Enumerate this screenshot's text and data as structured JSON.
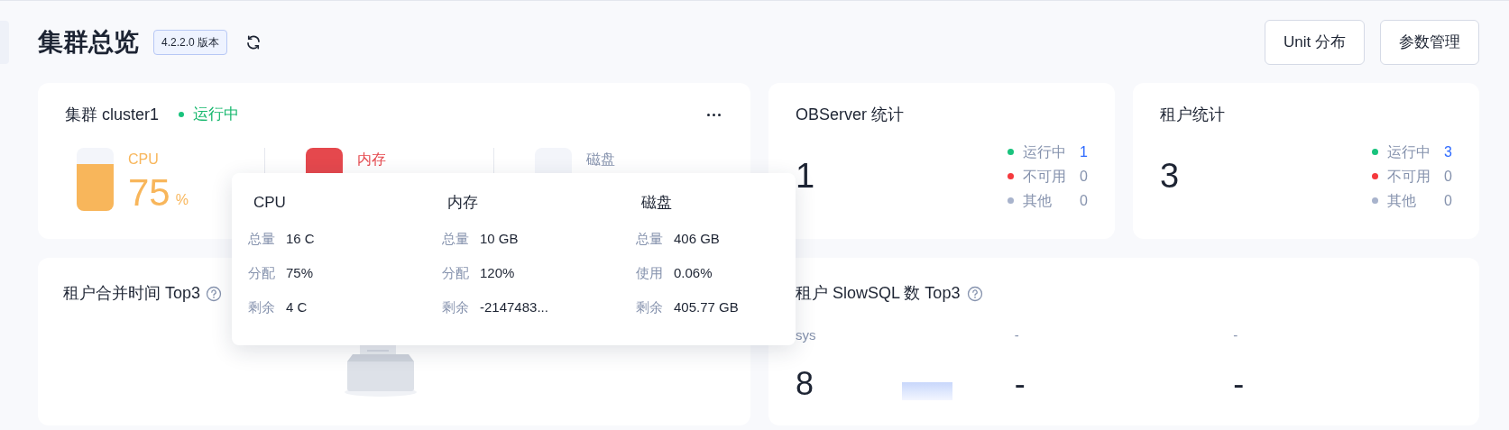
{
  "header": {
    "title": "集群总览",
    "version": "4.2.2.0 版本",
    "buttons": [
      "Unit 分布",
      "参数管理"
    ]
  },
  "cluster": {
    "name": "集群 cluster1",
    "status": "运行中",
    "metrics": [
      {
        "label": "CPU",
        "value": "75",
        "unit": "%",
        "level": 0.75,
        "color": "#f8b65b"
      },
      {
        "label": "内存",
        "level": 1,
        "color": "#e5484d"
      },
      {
        "label": "磁盘",
        "level": 0,
        "color": "#8592ad"
      }
    ]
  },
  "stats": [
    {
      "title": "OBServer 统计",
      "total": "1",
      "legend": [
        {
          "label": "运行中",
          "count": "1",
          "color": "#19c37d",
          "highlighted": true
        },
        {
          "label": "不可用",
          "count": "0",
          "color": "#f5393d",
          "highlighted": false
        },
        {
          "label": "其他",
          "count": "0",
          "color": "#a8b3cc",
          "highlighted": false
        }
      ]
    },
    {
      "title": "租户统计",
      "total": "3",
      "legend": [
        {
          "label": "运行中",
          "count": "3",
          "color": "#19c37d",
          "highlighted": true
        },
        {
          "label": "不可用",
          "count": "0",
          "color": "#f5393d",
          "highlighted": false
        },
        {
          "label": "其他",
          "count": "0",
          "color": "#a8b3cc",
          "highlighted": false
        }
      ]
    }
  ],
  "merge_card": {
    "title": "租户合并时间 Top3",
    "empty": true
  },
  "slowsql_card": {
    "title": "租户 SlowSQL 数 Top3",
    "tenants": [
      {
        "name": "sys",
        "count": "8",
        "kind": "trend"
      },
      {
        "name": "-",
        "count": "-",
        "kind": "plain"
      },
      {
        "name": "-",
        "count": "-",
        "kind": "plain"
      }
    ]
  },
  "tooltip": {
    "columns": [
      {
        "title": "CPU",
        "rows": [
          {
            "label": "总量",
            "value": "16 C"
          },
          {
            "label": "分配",
            "value": "75%"
          },
          {
            "label": "剩余",
            "value": "4 C"
          }
        ]
      },
      {
        "title": "内存",
        "rows": [
          {
            "label": "总量",
            "value": "10 GB"
          },
          {
            "label": "分配",
            "value": "120%"
          },
          {
            "label": "剩余",
            "value": "-2147483..."
          }
        ]
      },
      {
        "title": "磁盘",
        "rows": [
          {
            "label": "总量",
            "value": "406 GB"
          },
          {
            "label": "使用",
            "value": "0.06%"
          },
          {
            "label": "剩余",
            "value": "405.77 GB"
          }
        ]
      }
    ]
  }
}
